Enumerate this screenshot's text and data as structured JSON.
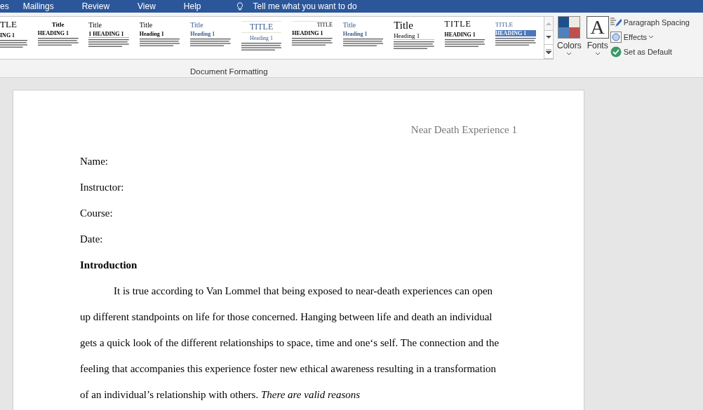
{
  "menu_tabs": [
    "es",
    "Mailings",
    "Review",
    "View",
    "Help"
  ],
  "tell_me": "Tell me what you want to do",
  "style_gallery": [
    {
      "kind": "classic",
      "title": "TLE",
      "heading": "ING 1"
    },
    {
      "kind": "bold",
      "title": "Title",
      "heading": "HEADING 1"
    },
    {
      "kind": "numbered",
      "title": "Title",
      "heading": "1  HEADING 1"
    },
    {
      "kind": "plain",
      "title": "Title",
      "heading": "Heading 1"
    },
    {
      "kind": "blue",
      "title": "Title",
      "heading": "Heading 1"
    },
    {
      "kind": "centered",
      "title": "TITLE",
      "heading": "Heading 1"
    },
    {
      "kind": "right",
      "title": "TITLE",
      "heading": "HEADING 1"
    },
    {
      "kind": "blue",
      "title": "Title",
      "heading": "Heading 1"
    },
    {
      "kind": "large",
      "title": "Title",
      "heading": "Heading 1"
    },
    {
      "kind": "caps",
      "title": "TITLE",
      "heading": "HEADING 1"
    },
    {
      "kind": "banded",
      "title": "TITLE",
      "heading": "HEADING 1"
    }
  ],
  "group_label": "Document Formatting",
  "colors_button": {
    "label": "Colors"
  },
  "fonts_button": {
    "label": "Fonts",
    "glyph": "A"
  },
  "side_commands": [
    {
      "kind": "spacing",
      "label": "Paragraph Spacing"
    },
    {
      "kind": "effects",
      "label": "Effects"
    },
    {
      "kind": "default",
      "label": "Set as Default"
    }
  ],
  "document": {
    "header": "Near Death Experience 1",
    "fields": [
      "Name:",
      "Instructor:",
      "Course:",
      "Date:"
    ],
    "section_heading": "Introduction",
    "paragraph": "It is true according to Van Lommel that being exposed to near-death experiences can open up different standpoints on life for those concerned. Hanging between life and death an individual gets a quick look of the different relationships to space, time and one‘s self. The connection and the feeling that accompanies this experience foster new ethical awareness resulting in a transformation of an individual’s relationship with others. *There are valid reasons*"
  }
}
